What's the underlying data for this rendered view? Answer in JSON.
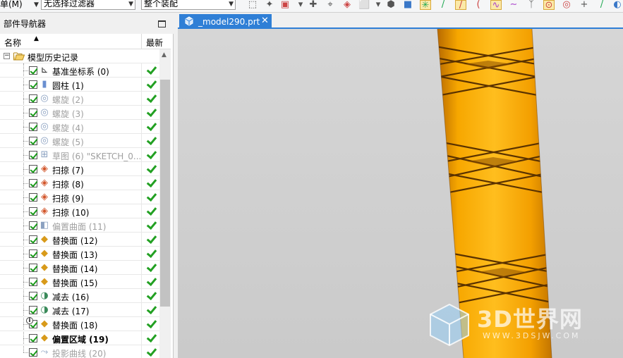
{
  "toolbar": {
    "menu_label": "单(M)",
    "filter_combo": "无选择过滤器",
    "assembly_combo": "整个装配"
  },
  "navigator": {
    "title": "部件导航器",
    "col_name": "名称",
    "col_latest": "最新",
    "history_label": "模型历史记录",
    "features": [
      {
        "label": "基准坐标系 (0)",
        "icon": "datum-csys-icon",
        "state": "normal"
      },
      {
        "label": "圆柱 (1)",
        "icon": "cylinder-icon",
        "state": "normal"
      },
      {
        "label": "螺旋 (2)",
        "icon": "helix-icon",
        "state": "dim"
      },
      {
        "label": "螺旋 (3)",
        "icon": "helix-icon",
        "state": "dim"
      },
      {
        "label": "螺旋 (4)",
        "icon": "helix-icon",
        "state": "dim"
      },
      {
        "label": "螺旋 (5)",
        "icon": "helix-icon",
        "state": "dim"
      },
      {
        "label": "草图 (6) \"SKETCH_0...",
        "icon": "sketch-icon",
        "state": "dim"
      },
      {
        "label": "扫掠 (7)",
        "icon": "sweep-icon",
        "state": "normal"
      },
      {
        "label": "扫掠 (8)",
        "icon": "sweep-icon",
        "state": "normal"
      },
      {
        "label": "扫掠 (9)",
        "icon": "sweep-icon",
        "state": "normal"
      },
      {
        "label": "扫掠 (10)",
        "icon": "sweep-icon",
        "state": "normal"
      },
      {
        "label": "偏置曲面 (11)",
        "icon": "offset-surface-icon",
        "state": "dim"
      },
      {
        "label": "替换面 (12)",
        "icon": "replace-face-icon",
        "state": "normal"
      },
      {
        "label": "替换面 (13)",
        "icon": "replace-face-icon",
        "state": "normal"
      },
      {
        "label": "替换面 (14)",
        "icon": "replace-face-icon",
        "state": "normal"
      },
      {
        "label": "替换面 (15)",
        "icon": "replace-face-icon",
        "state": "normal"
      },
      {
        "label": "减去 (16)",
        "icon": "subtract-icon",
        "state": "normal"
      },
      {
        "label": "减去 (17)",
        "icon": "subtract-icon",
        "state": "normal"
      },
      {
        "label": "替换面 (18)",
        "icon": "replace-face-icon",
        "state": "normal",
        "info": true
      },
      {
        "label": "偏置区域 (19)",
        "icon": "offset-region-icon",
        "state": "bold"
      },
      {
        "label": "投影曲线 (20)",
        "icon": "project-curve-icon",
        "state": "dim"
      }
    ]
  },
  "viewport": {
    "tab_label": "_model290.prt",
    "tab_close": "✕"
  },
  "watermark": {
    "title": "3D世界网",
    "url": "WWW.3DSJW.COM"
  },
  "colors": {
    "accent": "#2f7fd6",
    "model_orange": "#f4a100",
    "check_green": "#22a022"
  }
}
